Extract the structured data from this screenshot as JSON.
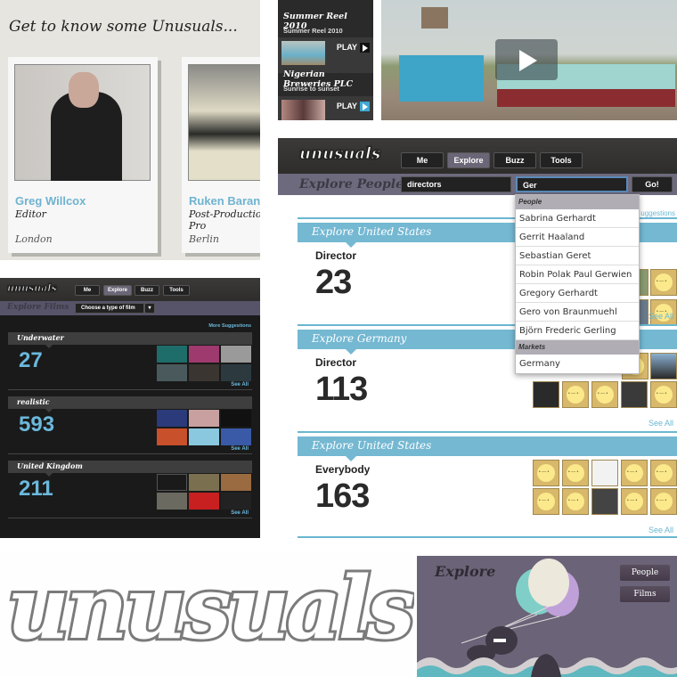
{
  "people_panel": {
    "heading": "Get to know some Unusuals...",
    "cards": [
      {
        "name": "Greg Willcox",
        "role": "Editor",
        "city": "London"
      },
      {
        "name": "Ruken Baran",
        "role": "Post-Production Co-ordinator & Producer",
        "role_visible": "Post-Production ordinator & Pro",
        "city": "Berlin"
      }
    ]
  },
  "video_panel": {
    "items": [
      {
        "title": "Summer Reel 2010",
        "subtitle": "Summer Reel 2010"
      },
      {
        "title": "Nigerian Breweries PLC",
        "subtitle": "Sunrise to sunset",
        "play_label": "PLAY"
      },
      {
        "title": "",
        "subtitle": "",
        "play_label": "PLAY"
      }
    ]
  },
  "explore_people": {
    "logo": "unusuals",
    "nav": [
      "Me",
      "Explore",
      "Buzz",
      "Tools"
    ],
    "active_nav": "Explore",
    "subtitle": "Explore People",
    "query_field": "directors",
    "search_field": "Ger",
    "go_label": "Go!",
    "more_suggestions": "More Suggestions",
    "more_suggestions_visible": "uggestions",
    "dropdown": {
      "people_header": "People",
      "people": [
        "Sabrina Gerhardt",
        "Gerrit Haaland",
        "Sebastian Geret",
        "Robin Polak Paul Gerwien",
        "Gregory Gerhardt",
        "Gero von Braunmuehl",
        "Björn Frederic Gerling"
      ],
      "markets_header": "Markets",
      "markets": [
        "Germany"
      ]
    },
    "sections": [
      {
        "title": "Explore United States",
        "label": "Director",
        "count": "23",
        "see_all": "See All"
      },
      {
        "title": "Explore Germany",
        "label": "Director",
        "count": "113",
        "see_all": "See All"
      },
      {
        "title": "Explore United States",
        "label": "Everybody",
        "count": "163",
        "see_all": "See All"
      }
    ]
  },
  "explore_films": {
    "logo": "unusuals",
    "nav": [
      "Me",
      "Explore",
      "Buzz",
      "Tools"
    ],
    "active_nav": "Explore",
    "subtitle": "Explore Films",
    "select_label": "Choose a type of film",
    "more_suggestions": "More Suggestions",
    "sections": [
      {
        "title": "Underwater",
        "count": "27",
        "see_all": "See All"
      },
      {
        "title": "realistic",
        "count": "593",
        "see_all": "See All"
      },
      {
        "title": "United Kingdom",
        "count": "211",
        "see_all": "See All"
      }
    ]
  },
  "brand": {
    "logo_text": "unusuals"
  },
  "explore_splash": {
    "title": "Explore",
    "buttons": [
      "People",
      "Films"
    ]
  },
  "colors": {
    "accent_blue": "#74b8d2",
    "dark_bar": "#2e2d2b",
    "purple_bar": "#6d6a7e",
    "splash_bg": "#6b6377"
  }
}
